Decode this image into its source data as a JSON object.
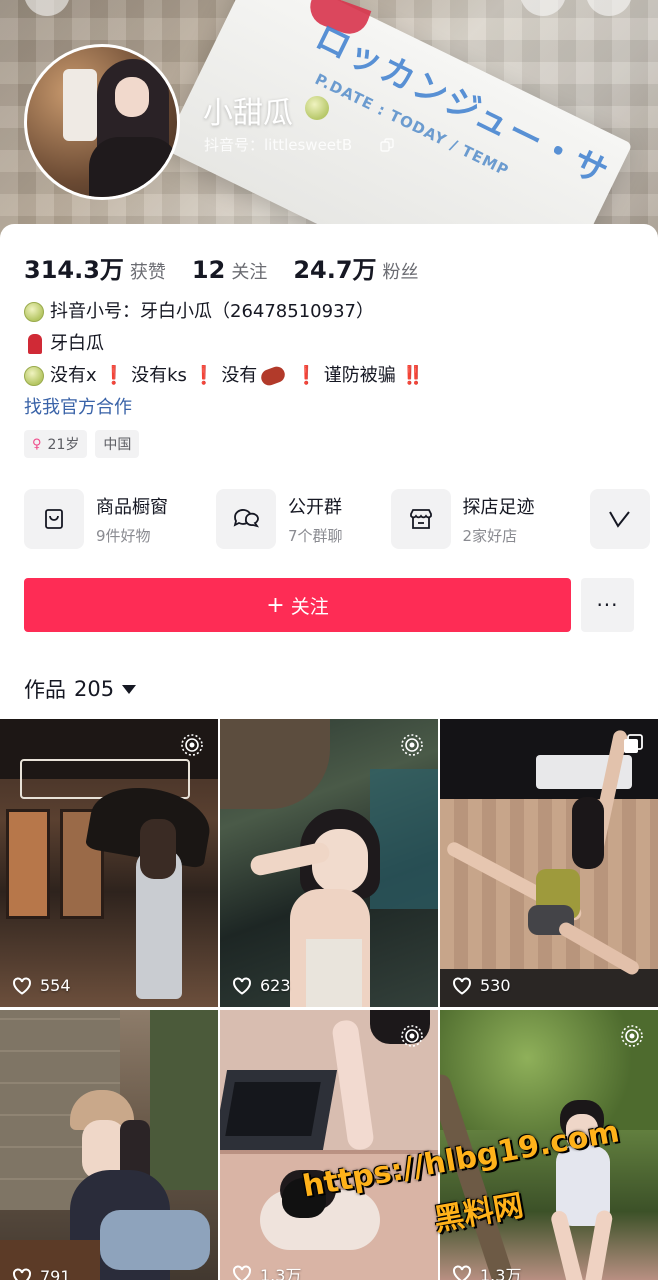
{
  "profile": {
    "nickname": "小甜瓜",
    "account_id": "抖音号：littlesweetB"
  },
  "stats": [
    {
      "value": "314.3万",
      "label": "获赞"
    },
    {
      "value": "12",
      "label": "关注"
    },
    {
      "value": "24.7万",
      "label": "粉丝"
    }
  ],
  "bio": {
    "line1": "抖音小号：牙白小瓜（26478510937）",
    "line2": "牙白瓜",
    "line3_a": "没有x",
    "line3_b": "没有ks",
    "line3_c": "没有",
    "line3_d": "谨防被骗",
    "link": "找我官方合作"
  },
  "tags": {
    "age": "21岁",
    "region": "中国"
  },
  "shortcuts": [
    {
      "title": "商品橱窗",
      "subtitle": "9件好物",
      "icon": "shopping-bag-icon"
    },
    {
      "title": "公开群",
      "subtitle": "7个群聊",
      "icon": "chat-bubbles-icon"
    },
    {
      "title": "探店足迹",
      "subtitle": "2家好店",
      "icon": "store-icon"
    }
  ],
  "actions": {
    "follow_label": "关注",
    "more_label": "···"
  },
  "works": {
    "label": "作品",
    "count": "205"
  },
  "videos": [
    {
      "likes": "554",
      "badge": "live-photo-icon"
    },
    {
      "likes": "623",
      "badge": "live-photo-icon"
    },
    {
      "likes": "530",
      "badge": "multi-image-icon"
    },
    {
      "likes": "791",
      "badge": ""
    },
    {
      "likes": "1.3万",
      "badge": "live-photo-icon"
    },
    {
      "likes": "1.3万",
      "badge": "live-photo-icon"
    }
  ],
  "banner_text": {
    "main": "ロッカンジュー・サ",
    "sub": "P.DATE : TODAY / TEMP"
  },
  "watermark": {
    "url": "https://hlbg19.com",
    "name": "黑料网"
  },
  "colors": {
    "accent": "#fe2c55",
    "link": "#3a63a8",
    "watermark": "#ffb21a"
  }
}
